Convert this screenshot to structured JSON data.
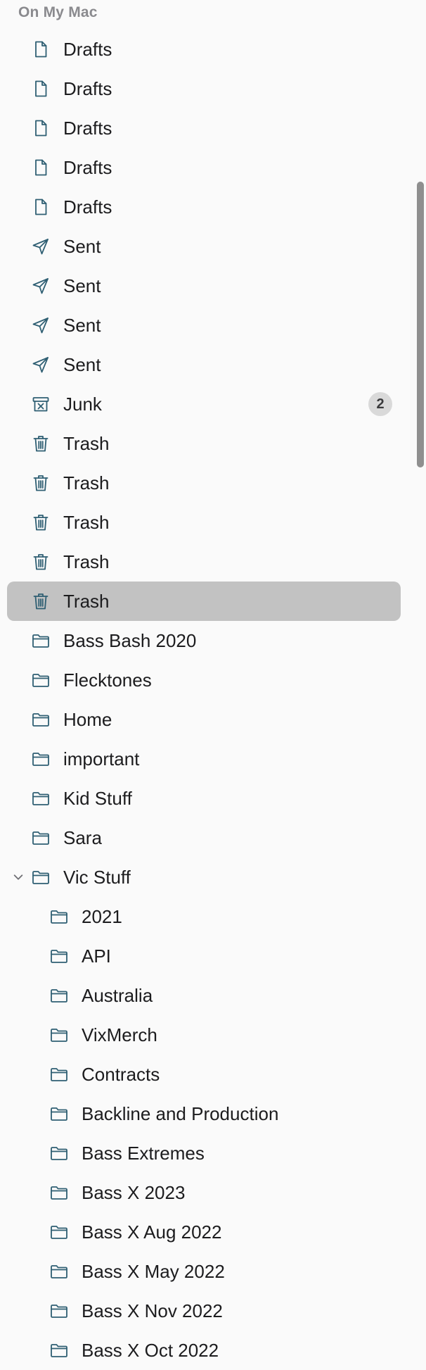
{
  "sidebar": {
    "section_title": "On My Mac",
    "items": [
      {
        "label": "Drafts",
        "icon": "document-icon",
        "level": 0
      },
      {
        "label": "Drafts",
        "icon": "document-icon",
        "level": 0
      },
      {
        "label": "Drafts",
        "icon": "document-icon",
        "level": 0
      },
      {
        "label": "Drafts",
        "icon": "document-icon",
        "level": 0
      },
      {
        "label": "Drafts",
        "icon": "document-icon",
        "level": 0
      },
      {
        "label": "Sent",
        "icon": "paper-plane-icon",
        "level": 0
      },
      {
        "label": "Sent",
        "icon": "paper-plane-icon",
        "level": 0
      },
      {
        "label": "Sent",
        "icon": "paper-plane-icon",
        "level": 0
      },
      {
        "label": "Sent",
        "icon": "paper-plane-icon",
        "level": 0
      },
      {
        "label": "Junk",
        "icon": "junk-icon",
        "level": 0,
        "badge": "2"
      },
      {
        "label": "Trash",
        "icon": "trash-icon",
        "level": 0
      },
      {
        "label": "Trash",
        "icon": "trash-icon",
        "level": 0
      },
      {
        "label": "Trash",
        "icon": "trash-icon",
        "level": 0
      },
      {
        "label": "Trash",
        "icon": "trash-icon",
        "level": 0
      },
      {
        "label": "Trash",
        "icon": "trash-icon",
        "level": 0,
        "selected": true
      },
      {
        "label": "Bass Bash 2020",
        "icon": "folder-icon",
        "level": 0
      },
      {
        "label": "Flecktones",
        "icon": "folder-icon",
        "level": 0
      },
      {
        "label": "Home",
        "icon": "folder-icon",
        "level": 0
      },
      {
        "label": "important",
        "icon": "folder-icon",
        "level": 0
      },
      {
        "label": "Kid Stuff",
        "icon": "folder-icon",
        "level": 0
      },
      {
        "label": "Sara",
        "icon": "folder-icon",
        "level": 0
      },
      {
        "label": "Vic Stuff",
        "icon": "folder-icon",
        "level": 0,
        "expanded": true
      },
      {
        "label": "2021",
        "icon": "folder-icon",
        "level": 1
      },
      {
        "label": "API",
        "icon": "folder-icon",
        "level": 1
      },
      {
        "label": "Australia",
        "icon": "folder-icon",
        "level": 1
      },
      {
        "label": "VixMerch",
        "icon": "folder-icon",
        "level": 1
      },
      {
        "label": "Contracts",
        "icon": "folder-icon",
        "level": 1
      },
      {
        "label": "Backline and Production",
        "icon": "folder-icon",
        "level": 1
      },
      {
        "label": "Bass Extremes",
        "icon": "folder-icon",
        "level": 1
      },
      {
        "label": "Bass X 2023",
        "icon": "folder-icon",
        "level": 1
      },
      {
        "label": "Bass X Aug 2022",
        "icon": "folder-icon",
        "level": 1
      },
      {
        "label": "Bass X May 2022",
        "icon": "folder-icon",
        "level": 1
      },
      {
        "label": "Bass X Nov 2022",
        "icon": "folder-icon",
        "level": 1
      },
      {
        "label": "Bass X Oct 2022",
        "icon": "folder-icon",
        "level": 1
      }
    ]
  },
  "colors": {
    "icon_stroke": "#2f5f73",
    "selection": "#c2c2c2",
    "badge_bg": "#d9d9d9",
    "section_header": "#8a8a8e",
    "scrollbar_thumb": "#8f8f8f"
  }
}
